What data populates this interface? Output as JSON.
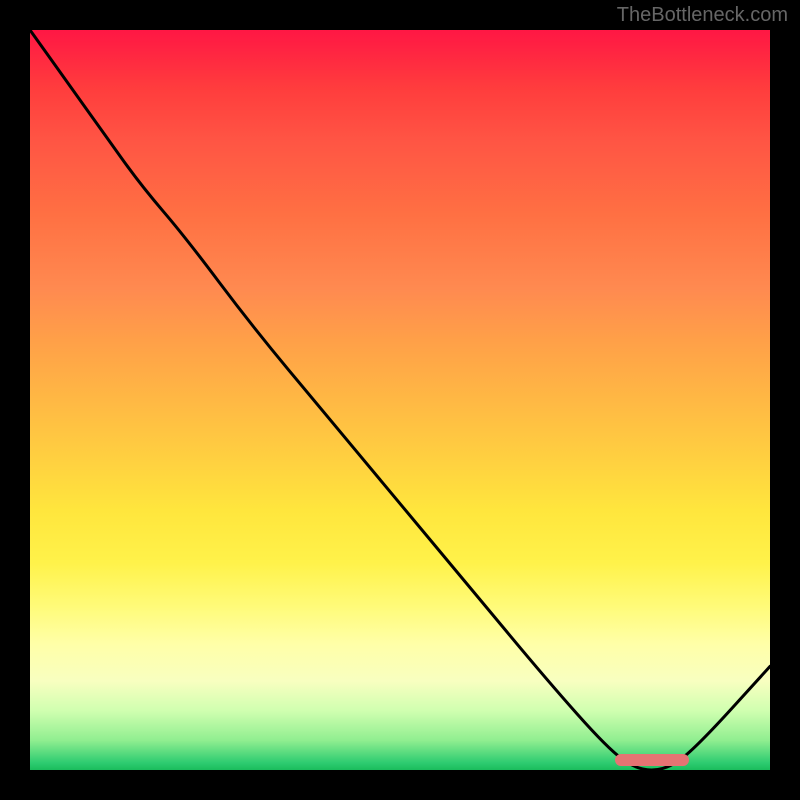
{
  "watermark": "TheBottleneck.com",
  "chart_data": {
    "type": "line",
    "title": "",
    "xlabel": "",
    "ylabel": "",
    "x": [
      0,
      5,
      10,
      15,
      21,
      30,
      40,
      50,
      60,
      70,
      78,
      82,
      86,
      90,
      100
    ],
    "values": [
      100,
      93,
      86,
      79,
      72,
      60,
      48,
      36,
      24,
      12,
      3,
      0,
      0,
      3,
      14
    ],
    "ylim": [
      0,
      100
    ],
    "xlim": [
      0,
      100
    ],
    "marker": {
      "x_start": 79,
      "x_end": 89,
      "y": 0
    },
    "colors": {
      "gradient_top": "#ff1744",
      "gradient_mid": "#ffe63d",
      "gradient_bottom": "#2ecc71",
      "line": "#000000",
      "marker": "#e57373",
      "background": "#000000"
    }
  }
}
